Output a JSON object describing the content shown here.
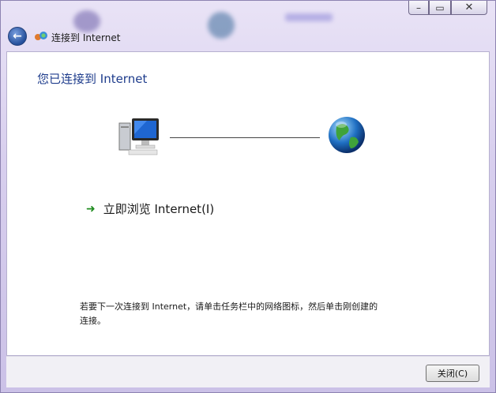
{
  "window": {
    "title": "连接到 Internet",
    "caption_min": "–",
    "caption_max": "▭",
    "caption_close": "✕"
  },
  "content": {
    "heading": "您已连接到 Internet",
    "browse_link": "立即浏览 Internet(I)",
    "note": "若要下一次连接到 Internet，请单击任务栏中的网络图标，然后单击刚创建的连接。"
  },
  "footer": {
    "close_button": "关闭(C)"
  },
  "colors": {
    "heading": "#1e3c8c",
    "link_arrow": "#1f8c1f",
    "window_chrome": "#d8cfee"
  },
  "icons": [
    "back-arrow-icon",
    "network-icon",
    "computer-icon",
    "globe-icon",
    "green-arrow-icon"
  ]
}
